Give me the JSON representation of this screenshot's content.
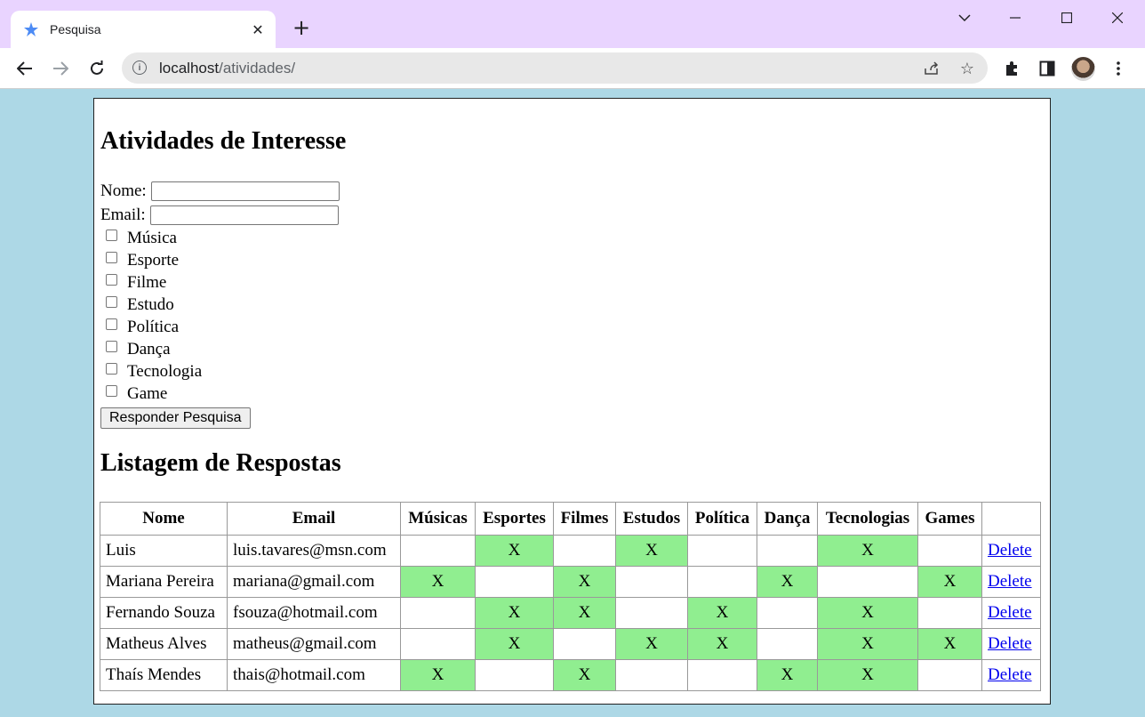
{
  "browser": {
    "tab_title": "Pesquisa",
    "url_host": "localhost",
    "url_path": "/atividades/",
    "accent_color": "#e9d4ff"
  },
  "page": {
    "title": "Atividades de Interesse",
    "form": {
      "nome_label": "Nome:",
      "nome_value": "",
      "email_label": "Email:",
      "email_value": "",
      "options": [
        "Música",
        "Esporte",
        "Filme",
        "Estudo",
        "Política",
        "Dança",
        "Tecnologia",
        "Game"
      ],
      "submit_label": "Responder Pesquisa"
    },
    "list_title": "Listagem de Respostas",
    "table": {
      "headers": [
        "Nome",
        "Email",
        "Músicas",
        "Esportes",
        "Filmes",
        "Estudos",
        "Política",
        "Dança",
        "Tecnologias",
        "Games",
        ""
      ],
      "mark": "X",
      "delete_label": "Delete",
      "highlight_color": "#90ee90",
      "rows": [
        {
          "nome": "Luis",
          "email": "luis.tavares@msn.com",
          "marks": [
            false,
            true,
            false,
            true,
            false,
            false,
            true,
            false
          ]
        },
        {
          "nome": "Mariana Pereira",
          "email": "mariana@gmail.com",
          "marks": [
            true,
            false,
            true,
            false,
            false,
            true,
            false,
            true
          ]
        },
        {
          "nome": "Fernando Souza",
          "email": "fsouza@hotmail.com",
          "marks": [
            false,
            true,
            true,
            false,
            true,
            false,
            true,
            false
          ]
        },
        {
          "nome": "Matheus Alves",
          "email": "matheus@gmail.com",
          "marks": [
            false,
            true,
            false,
            true,
            true,
            false,
            true,
            true
          ]
        },
        {
          "nome": "Thaís Mendes",
          "email": "thais@hotmail.com",
          "marks": [
            true,
            false,
            true,
            false,
            false,
            true,
            true,
            false
          ]
        }
      ]
    }
  }
}
